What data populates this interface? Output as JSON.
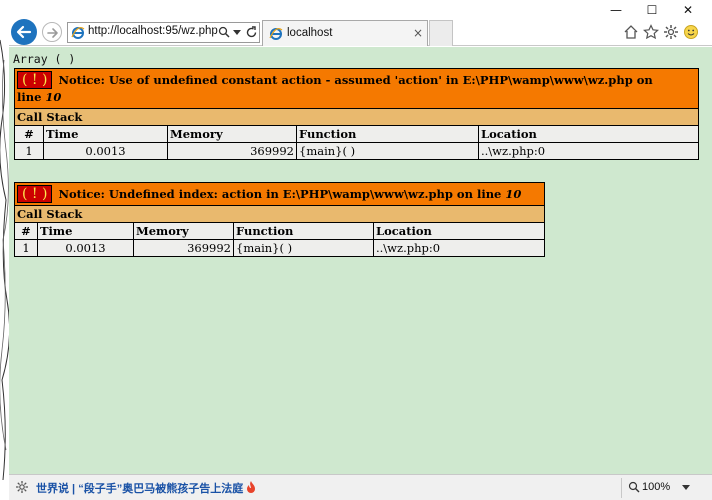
{
  "window": {
    "minimize": "—",
    "maximize": "☐",
    "close": "✕"
  },
  "address": {
    "url": "http://localhost:95/wz.php"
  },
  "tab": {
    "title": "localhost",
    "close": "×"
  },
  "content": {
    "array_output": "Array ( )",
    "errors": [
      {
        "badge": "( ! )",
        "message_lines": [
          "Notice: Use of undefined constant action - assumed 'action' in E:\\PHP\\wamp\\www\\wz.php on",
          "line "
        ],
        "line_no": "10",
        "call_stack_label": "Call Stack",
        "headers": [
          "#",
          "Time",
          "Memory",
          "Function",
          "Location"
        ],
        "row": {
          "num": "1",
          "time": "0.0013",
          "memory": "369992",
          "function": "{main}( )",
          "location": "..\\wz.php:0"
        }
      },
      {
        "badge": "( ! )",
        "message": "Notice: Undefined index: action in E:\\PHP\\wamp\\www\\wz.php on line ",
        "line_no": "10",
        "call_stack_label": "Call Stack",
        "headers": [
          "#",
          "Time",
          "Memory",
          "Function",
          "Location"
        ],
        "row": {
          "num": "1",
          "time": "0.0013",
          "memory": "369992",
          "function": "{main}( )",
          "location": "..\\wz.php:0"
        }
      }
    ]
  },
  "statusbar": {
    "news": "世界说 | “段子手”奥巴马被熊孩子告上法庭",
    "zoom": "100%"
  },
  "colors": {
    "content_bg": "#cfe8cf",
    "notice_bg": "#f57900",
    "badge_bg": "#cc0000",
    "badge_fg": "#fce94f",
    "callstack_bg": "#e9b96e",
    "cell_bg": "#eeeeec",
    "ie_blue": "#1e73be"
  },
  "icons": [
    "back-arrow-icon",
    "forward-arrow-icon",
    "ie-logo-icon",
    "search-icon",
    "chevron-down-icon",
    "refresh-icon",
    "home-icon",
    "favorites-star-icon",
    "gear-icon",
    "smiley-feedback-icon",
    "fire-icon",
    "zoom-icon"
  ]
}
